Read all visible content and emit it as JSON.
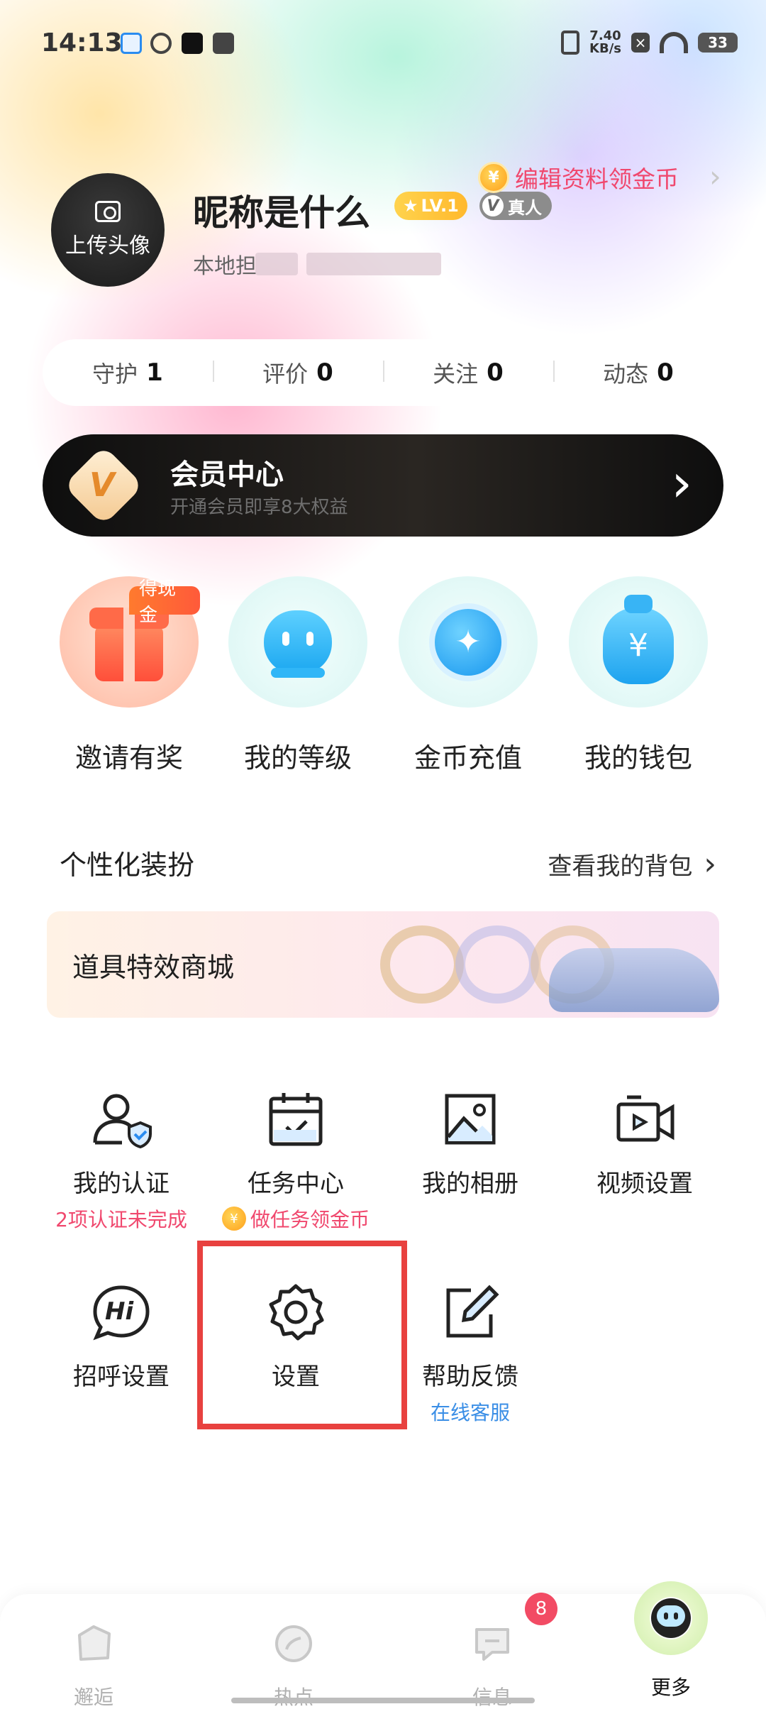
{
  "status_bar": {
    "time": "14:13",
    "net_speed_value": "7.40",
    "net_speed_unit": "KB/s",
    "battery": "33"
  },
  "profile": {
    "avatar_label": "上传头像",
    "nickname": "昵称是什么",
    "level": "LV.1",
    "real_badge_letter": "V",
    "real_badge": "真人",
    "edit_reward": "编辑资料领金币",
    "coin_symbol": "¥",
    "location": "本地担"
  },
  "stats": [
    {
      "label": "守护",
      "value": "1"
    },
    {
      "label": "评价",
      "value": "0"
    },
    {
      "label": "关注",
      "value": "0"
    },
    {
      "label": "动态",
      "value": "0"
    }
  ],
  "vip": {
    "title": "会员中心",
    "subtitle": "开通会员即享8大权益",
    "icon_letter": "V"
  },
  "quick_actions": [
    {
      "label": "邀请有奖",
      "tag": "得现金"
    },
    {
      "label": "我的等级"
    },
    {
      "label": "金币充值"
    },
    {
      "label": "我的钱包",
      "symbol": "¥"
    }
  ],
  "personalize": {
    "title": "个性化装扮",
    "link": "查看我的背包",
    "banner": "道具特效商城"
  },
  "menu": [
    {
      "label": "我的认证",
      "sub": "2项认证未完成",
      "icon": "user-shield-icon"
    },
    {
      "label": "任务中心",
      "sub": "做任务领金币",
      "icon": "calendar-check-icon"
    },
    {
      "label": "我的相册",
      "icon": "image-icon"
    },
    {
      "label": "视频设置",
      "icon": "video-camera-icon"
    },
    {
      "label": "招呼设置",
      "icon_text": "Hi",
      "icon": "hi-chat-icon"
    },
    {
      "label": "设置",
      "icon": "gear-icon"
    },
    {
      "label": "帮助反馈",
      "sub": "在线客服",
      "icon": "edit-icon"
    }
  ],
  "bottom_nav": {
    "items": [
      {
        "label": "邂逅",
        "icon": "encounter-icon"
      },
      {
        "label": "热点",
        "icon": "hotspot-icon"
      },
      {
        "label": "信息",
        "icon": "chat-bubble-icon",
        "badge": "8"
      },
      {
        "label": "更多",
        "icon": "more-avatar-icon"
      }
    ]
  },
  "colors": {
    "accent_red": "#f0486e",
    "link_blue": "#3a8ee6",
    "highlight": "#e8413f",
    "badge": "#f24b64"
  }
}
